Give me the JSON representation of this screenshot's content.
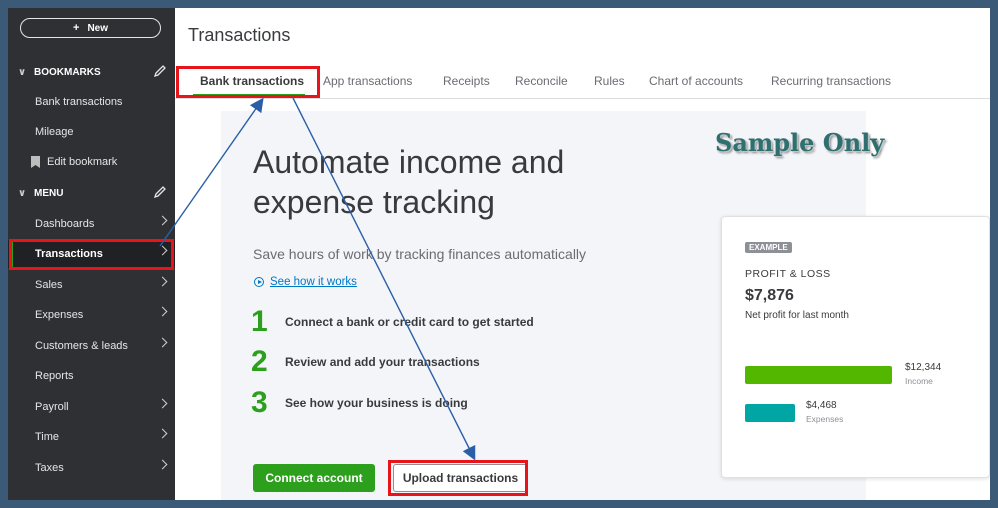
{
  "sidebar": {
    "new_label": "New",
    "bookmarks_title": "BOOKMARKS",
    "bookmarks": [
      {
        "label": "Bank transactions"
      },
      {
        "label": "Mileage"
      },
      {
        "label": "Edit bookmark"
      }
    ],
    "menu_title": "MENU",
    "menu": [
      {
        "label": "Dashboards",
        "has_arrow": true
      },
      {
        "label": "Transactions",
        "has_arrow": true,
        "active": true
      },
      {
        "label": "Sales",
        "has_arrow": true
      },
      {
        "label": "Expenses",
        "has_arrow": true
      },
      {
        "label": "Customers & leads",
        "has_arrow": true
      },
      {
        "label": "Reports",
        "has_arrow": false
      },
      {
        "label": "Payroll",
        "has_arrow": true
      },
      {
        "label": "Time",
        "has_arrow": true
      },
      {
        "label": "Taxes",
        "has_arrow": true
      }
    ]
  },
  "header": {
    "title": "Transactions"
  },
  "tabs": [
    {
      "label": "Bank transactions",
      "active": true
    },
    {
      "label": "App transactions"
    },
    {
      "label": "Receipts"
    },
    {
      "label": "Reconcile"
    },
    {
      "label": "Rules"
    },
    {
      "label": "Chart of accounts"
    },
    {
      "label": "Recurring transactions"
    }
  ],
  "main": {
    "headline": "Automate income and expense tracking",
    "subline": "Save hours of work by tracking finances automatically",
    "how_link": "See how it works",
    "steps": [
      {
        "num": "1",
        "text": "Connect a bank or credit card to get started"
      },
      {
        "num": "2",
        "text": "Review and add your transactions"
      },
      {
        "num": "3",
        "text": "See how your business is doing"
      }
    ],
    "connect_label": "Connect account",
    "upload_label": "Upload transactions"
  },
  "watermark": "Sample Only",
  "card": {
    "badge": "EXAMPLE",
    "title": "PROFIT & LOSS",
    "amount": "$7,876",
    "caption": "Net profit for last month",
    "income_value": "$12,344",
    "income_label": "Income",
    "expenses_value": "$4,468",
    "expenses_label": "Expenses",
    "income_color": "#53b700",
    "expenses_color": "#00a6a4"
  },
  "colors": {
    "accent": "#2ca01c",
    "highlight": "#e8141c",
    "link": "#0077c5",
    "sidebar": "#2e3034"
  }
}
